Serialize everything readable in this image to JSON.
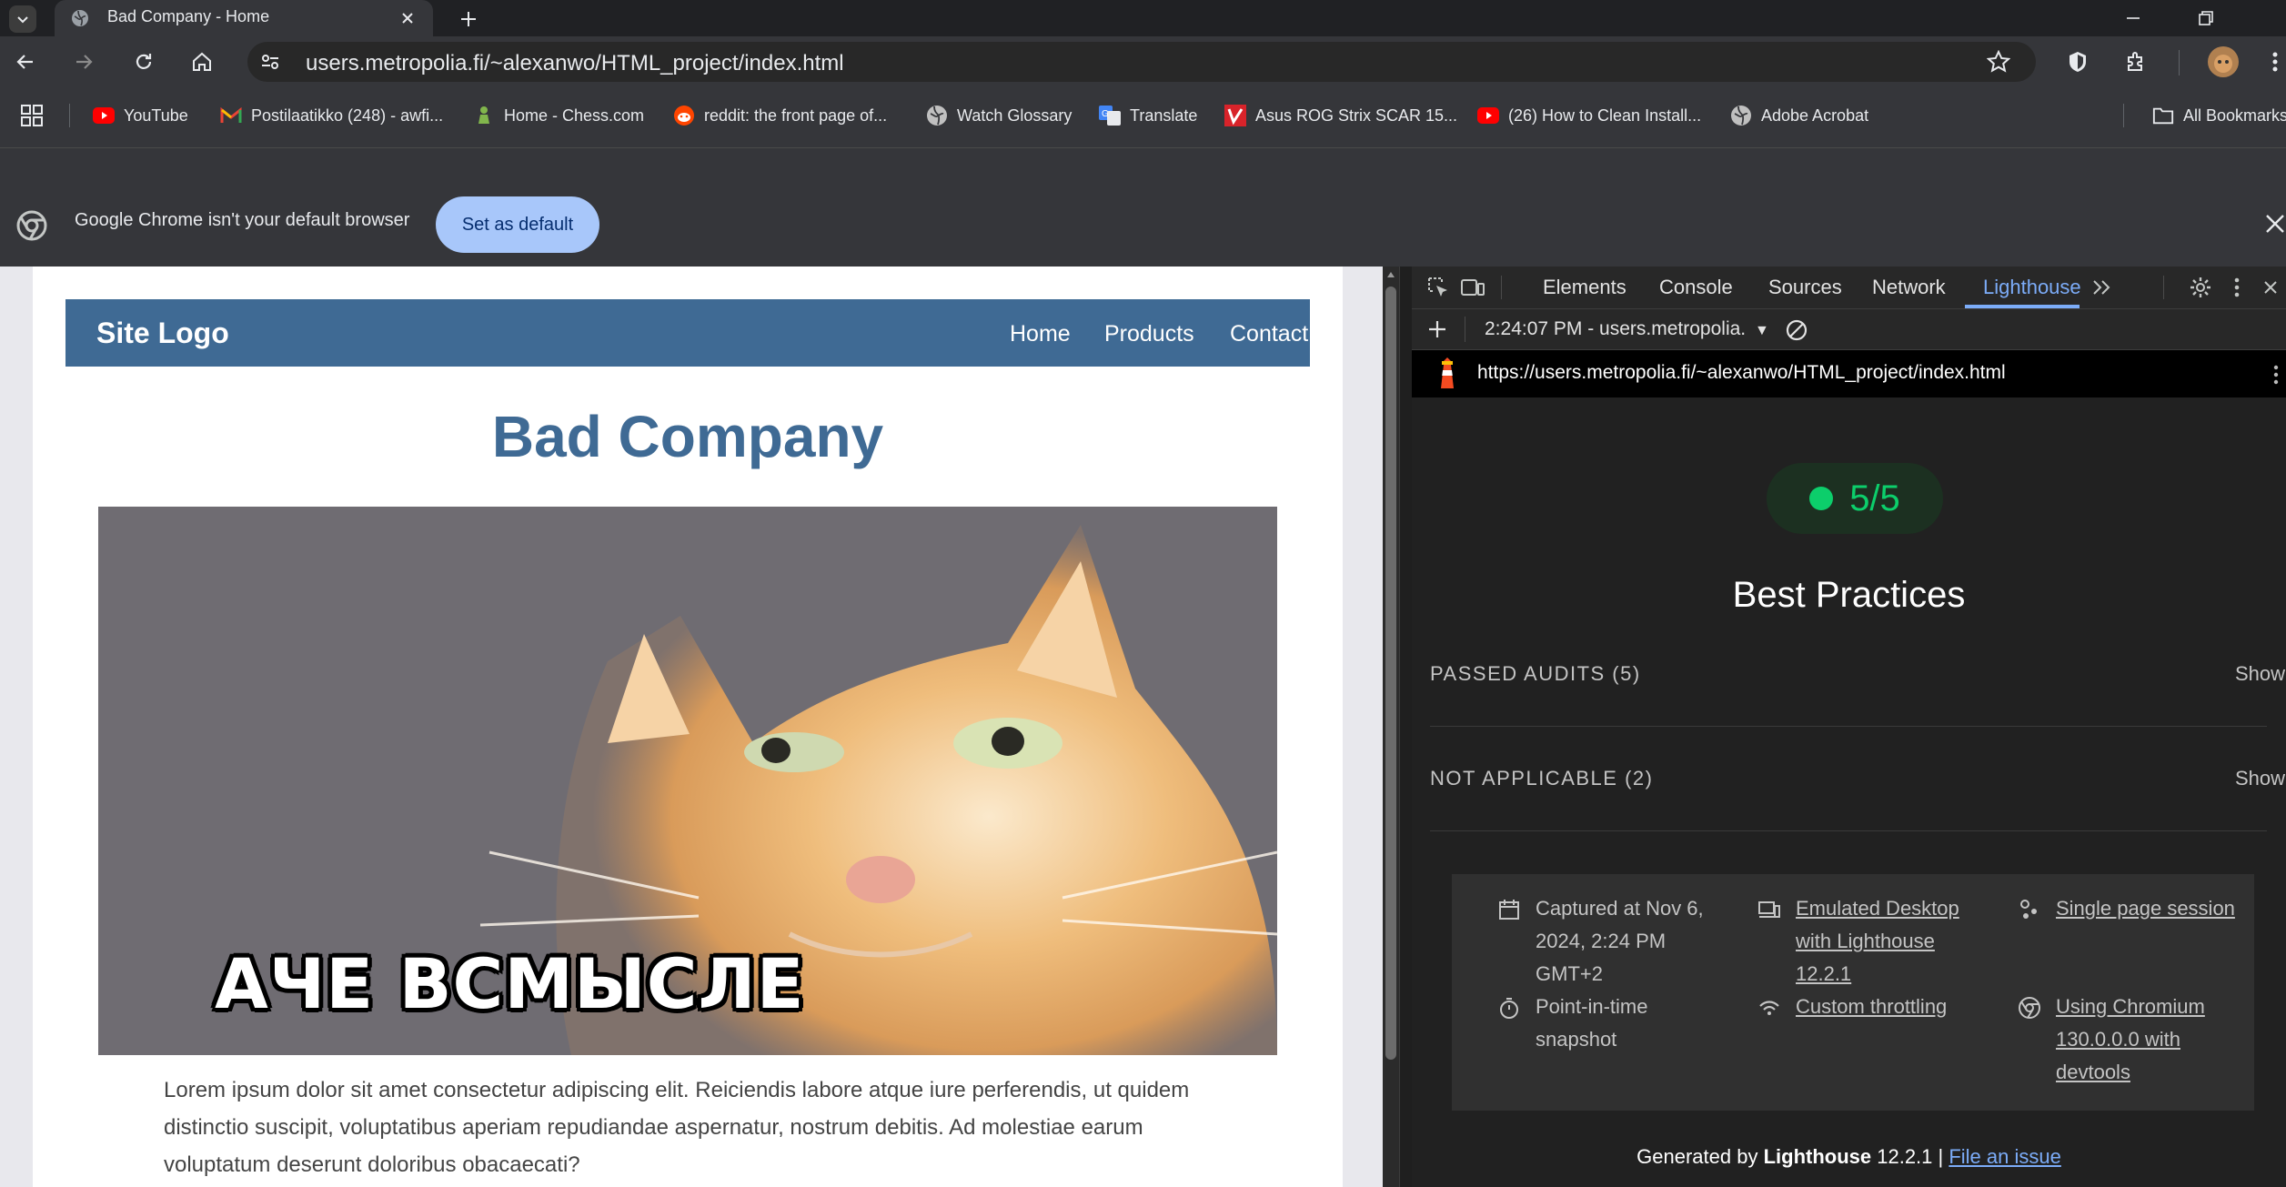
{
  "browser": {
    "tab": {
      "title": "Bad Company - Home"
    },
    "url": "users.metropolia.fi/~alexanwo/HTML_project/index.html",
    "bookmarks": [
      {
        "label": "YouTube",
        "icon": "youtube-icon"
      },
      {
        "label": "Postilaatikko (248) - awfi...",
        "icon": "gmail-icon"
      },
      {
        "label": "Home - Chess.com",
        "icon": "chess-icon"
      },
      {
        "label": "reddit: the front page of...",
        "icon": "reddit-icon"
      },
      {
        "label": "Watch Glossary",
        "icon": "globe-icon"
      },
      {
        "label": "Translate",
        "icon": "translate-icon"
      },
      {
        "label": "Asus ROG Strix SCAR 15...",
        "icon": "vivino-icon"
      },
      {
        "label": "(26) How to Clean Install...",
        "icon": "youtube-icon"
      },
      {
        "label": "Adobe Acrobat",
        "icon": "globe-icon"
      }
    ],
    "all_bookmarks": "All Bookmarks",
    "infobar": {
      "message": "Google Chrome isn't your default browser",
      "button": "Set as default"
    }
  },
  "page": {
    "logo": "Site Logo",
    "nav": [
      "Home",
      "Products",
      "Contact"
    ],
    "title": "Bad Company",
    "hero_caption": "АЧЕ ВСМЫСЛЕ",
    "paragraph": "Lorem ipsum dolor sit amet consectetur adipiscing elit. Reiciendis labore atque iure perferendis, ut quidem distinctio suscipit, voluptatibus aperiam repudiandae aspernatur, nostrum debitis. Ad molestiae earum voluptatum deserunt doloribus obacaecati?"
  },
  "devtools": {
    "tabs": [
      "Elements",
      "Console",
      "Sources",
      "Network",
      "Lighthouse"
    ],
    "active_tab": "Lighthouse",
    "report_select": "2:24:07 PM - users.metropolia.",
    "report_url": "https://users.metropolia.fi/~alexanwo/HTML_project/index.html",
    "score": "5/5",
    "score_color": "#0cce6b",
    "category": "Best Practices",
    "groups": [
      {
        "label": "PASSED AUDITS (5)",
        "action": "Show"
      },
      {
        "label": "NOT APPLICABLE (2)",
        "action": "Show"
      }
    ],
    "env": {
      "captured": "Captured at Nov 6, 2024, 2:24 PM GMT+2",
      "snapshot": "Point-in-time snapshot",
      "device": "Emulated Desktop with Lighthouse 12.2.1",
      "throttling": "Custom throttling",
      "session": "Single page session",
      "chromium": "Using Chromium 130.0.0.0 with devtools"
    },
    "footer": {
      "prefix": "Generated by ",
      "product": "Lighthouse",
      "version": " 12.2.1 | ",
      "link": "File an issue"
    }
  }
}
